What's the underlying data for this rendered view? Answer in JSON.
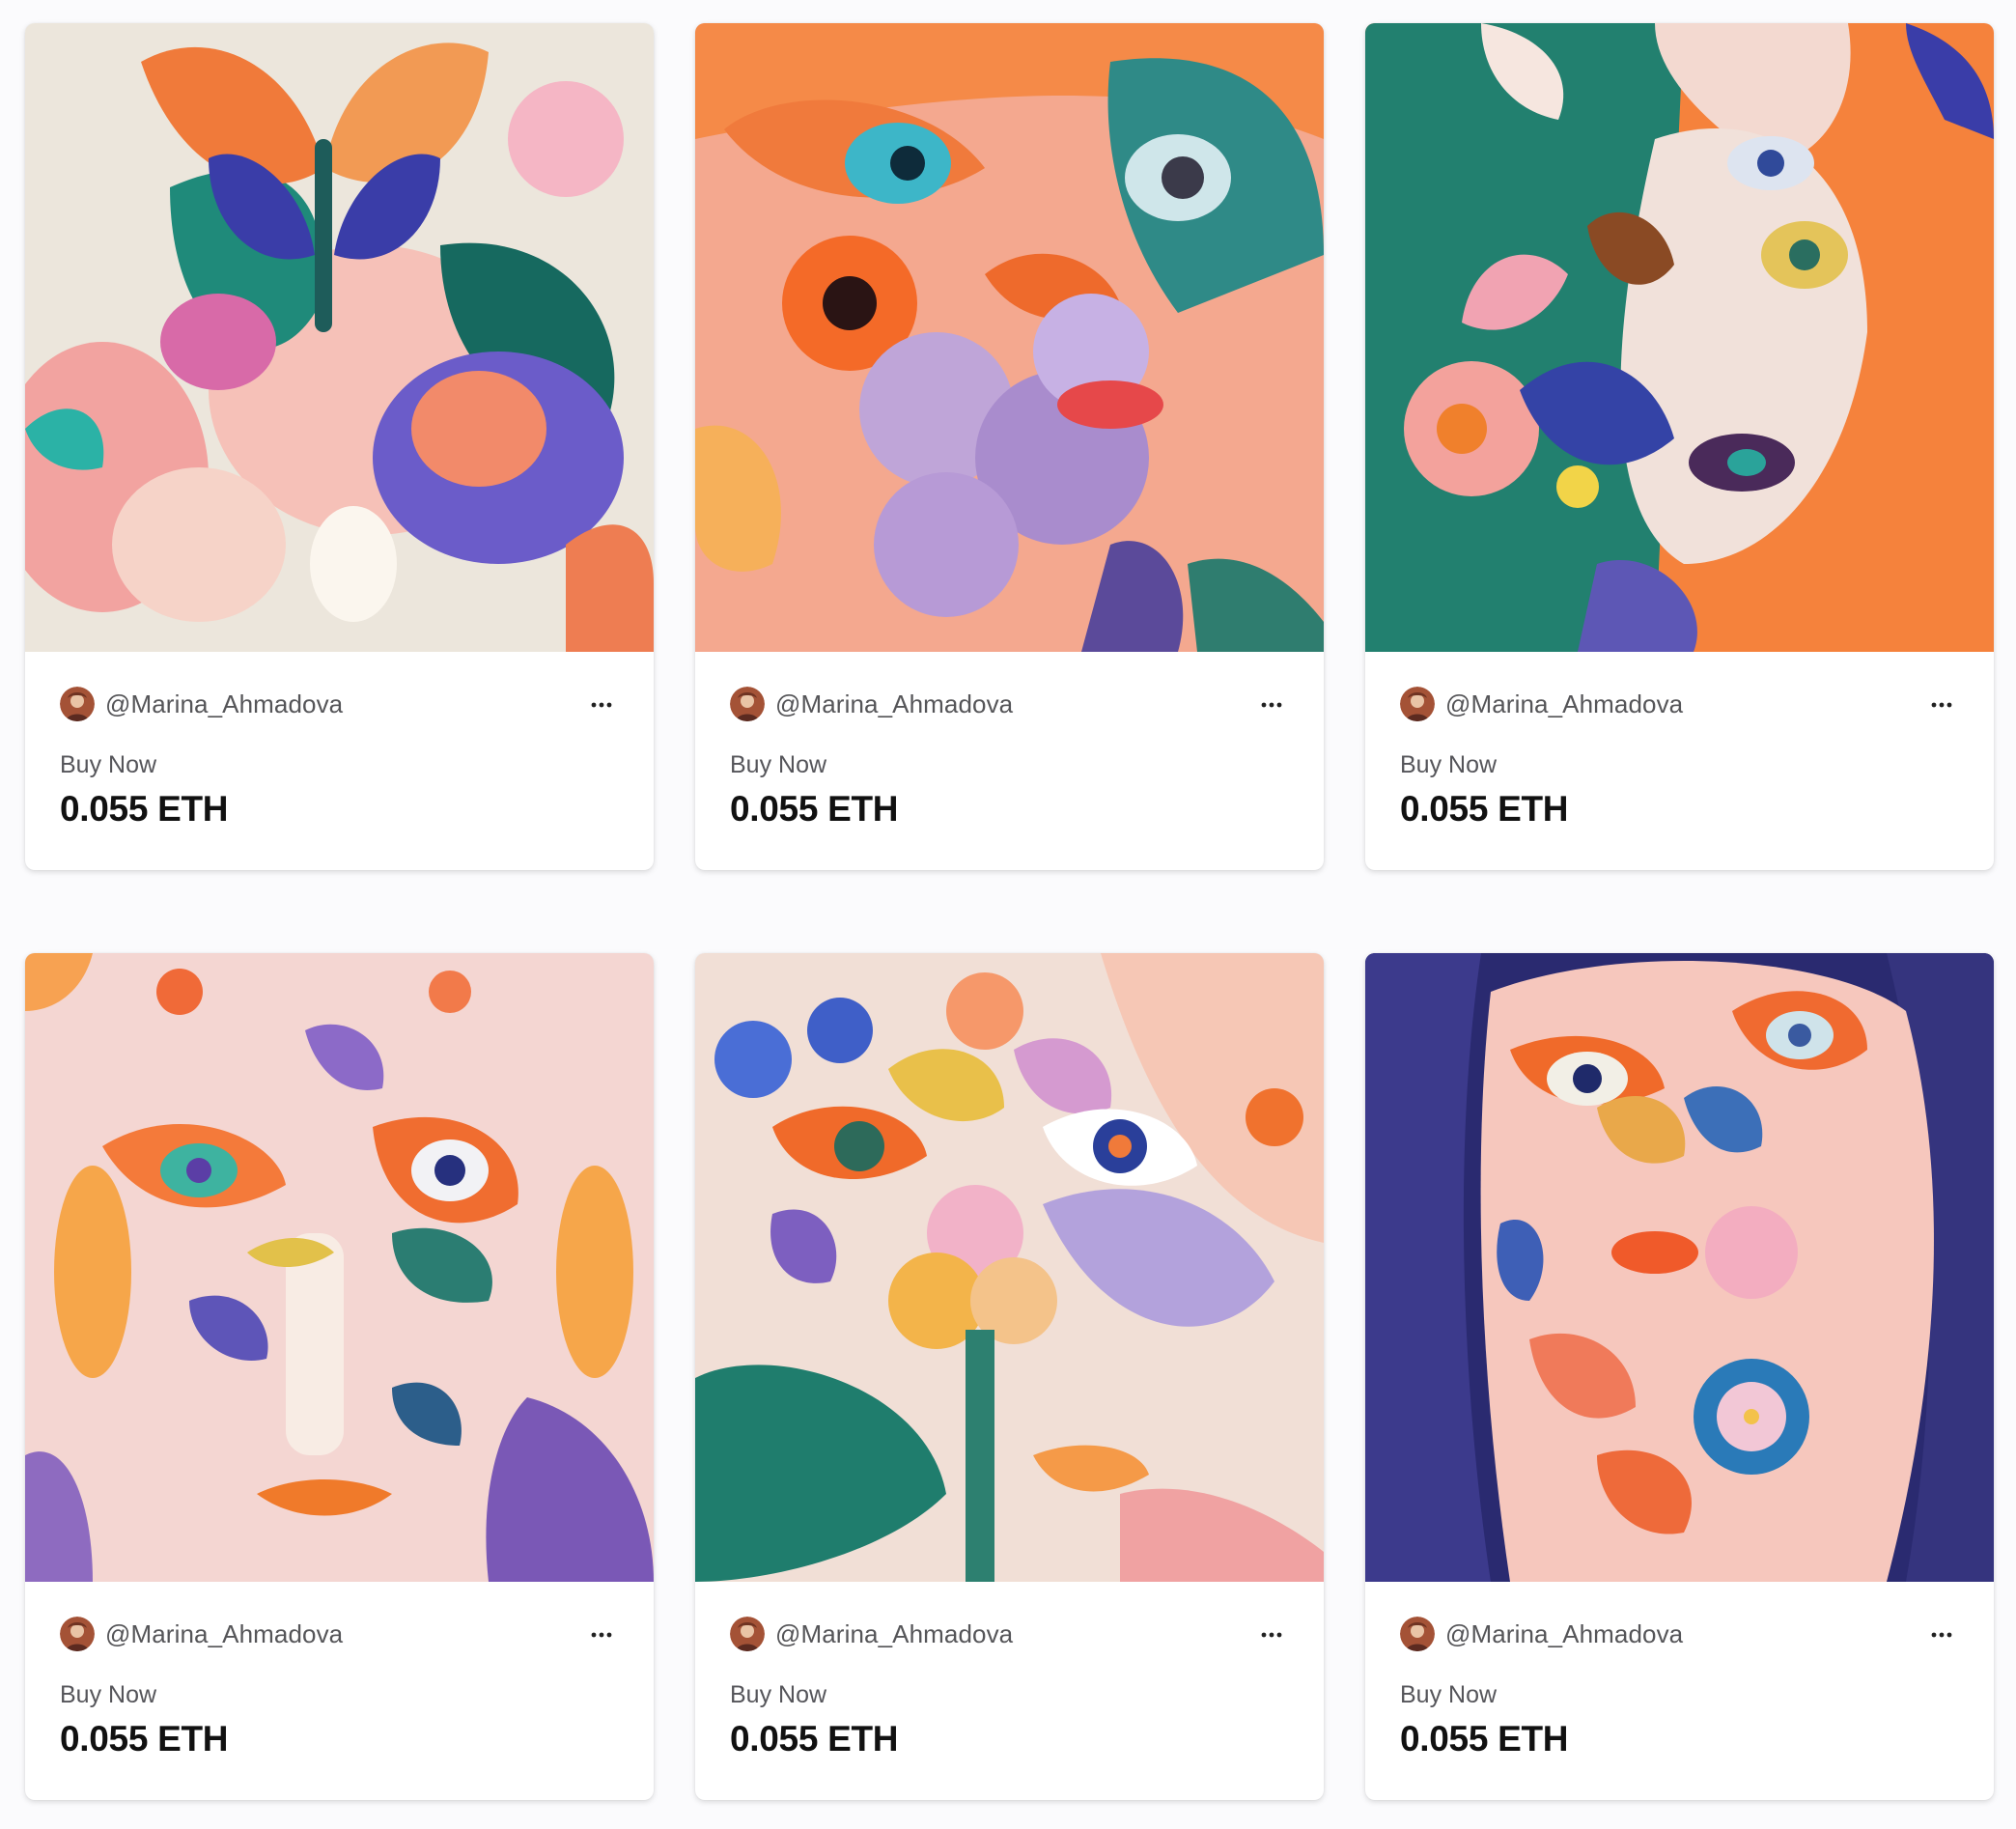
{
  "cards": [
    {
      "artwork": "abstract-butterfly-flowers",
      "creator": "@Marina_Ahmadova",
      "sale_label": "Buy Now",
      "price": "0.055 ETH"
    },
    {
      "artwork": "abstract-face-orange-eyes",
      "creator": "@Marina_Ahmadova",
      "sale_label": "Buy Now",
      "price": "0.055 ETH"
    },
    {
      "artwork": "abstract-face-butterfly-orange",
      "creator": "@Marina_Ahmadova",
      "sale_label": "Buy Now",
      "price": "0.055 ETH"
    },
    {
      "artwork": "abstract-face-pink-mask",
      "creator": "@Marina_Ahmadova",
      "sale_label": "Buy Now",
      "price": "0.055 ETH"
    },
    {
      "artwork": "abstract-face-flowers-eyes",
      "creator": "@Marina_Ahmadova",
      "sale_label": "Buy Now",
      "price": "0.055 ETH"
    },
    {
      "artwork": "abstract-face-dark-hair",
      "creator": "@Marina_Ahmadova",
      "sale_label": "Buy Now",
      "price": "0.055 ETH"
    }
  ],
  "icons": {
    "more": "more-horizontal-icon",
    "avatar": "creator-avatar"
  },
  "colors": {
    "page_background": "#fbfbfd",
    "card_background": "#ffffff",
    "price_text": "#111111",
    "secondary_text": "#55555a"
  }
}
